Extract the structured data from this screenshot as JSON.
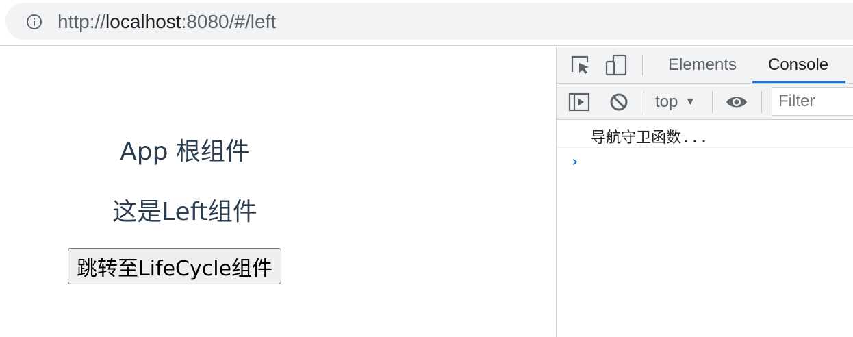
{
  "browser": {
    "url_scheme": "http://",
    "url_host": "localhost",
    "url_path": ":8080/#/left"
  },
  "page": {
    "app_title": "App 根组件",
    "left_text": "这是Left组件",
    "button_label": "跳转至LifeCycle组件"
  },
  "devtools": {
    "tabs": [
      {
        "label": "Elements",
        "active": false
      },
      {
        "label": "Console",
        "active": true
      }
    ],
    "context": "top",
    "filter_placeholder": "Filter",
    "console_messages": [
      "导航守卫函数..."
    ],
    "prompt_symbol": "›",
    "accent_color": "#1a73e8"
  },
  "icons": [
    "info-icon",
    "inspect-element-icon",
    "device-toolbar-icon",
    "sidebar-toggle-icon",
    "clear-console-icon",
    "eye-icon",
    "dropdown-arrow-icon"
  ]
}
